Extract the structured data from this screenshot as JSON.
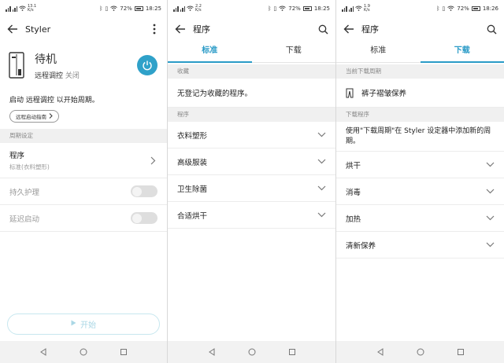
{
  "status": {
    "s1": {
      "net": "13.1\nK/s",
      "time": "18:25",
      "battery": "72%"
    },
    "s2": {
      "net": "2.2\nK/s",
      "time": "18:25",
      "battery": "72%"
    },
    "s3": {
      "net": "1.9\nK/s",
      "time": "18:26",
      "battery": "72%"
    }
  },
  "screen1": {
    "title": "Styler",
    "device_status": "待机",
    "remote_label": "远程调控",
    "remote_value": "关闭",
    "prompt": "启动 远程调控 以开始周期。",
    "guide_button": "远程启动指南",
    "section": "周期设定",
    "program_label": "程序",
    "program_value": "标准(衣料塑形)",
    "option1": "持久护理",
    "option2": "延迟启动",
    "start_button": "开始"
  },
  "screen2": {
    "title": "程序",
    "tabs": [
      "标准",
      "下载"
    ],
    "fav_section": "收藏",
    "fav_empty": "无登记为收藏的程序。",
    "prog_section": "程序",
    "programs": [
      "衣料塑形",
      "高级服装",
      "卫生除菌",
      "合适烘干"
    ]
  },
  "screen3": {
    "title": "程序",
    "tabs": [
      "标准",
      "下载"
    ],
    "current_section": "当前下载周期",
    "current_item": "裤子褶皱保养",
    "dl_section": "下载程序",
    "dl_note": "使用\"下载周期\"在 Styler 设定器中添加新的周期。",
    "programs": [
      "烘干",
      "消毒",
      "加热",
      "清新保养"
    ]
  },
  "colors": {
    "accent": "#2a9bc7",
    "power": "#2fa1c9",
    "disabled": "#aad7e5"
  },
  "icons": {
    "back": "back-arrow-icon",
    "more": "more-vert-icon",
    "search": "search-icon",
    "power": "power-icon",
    "chevron": "chevron-down-icon",
    "chevron_right": "chevron-right-icon",
    "play": "play-icon",
    "pants": "pants-icon"
  }
}
